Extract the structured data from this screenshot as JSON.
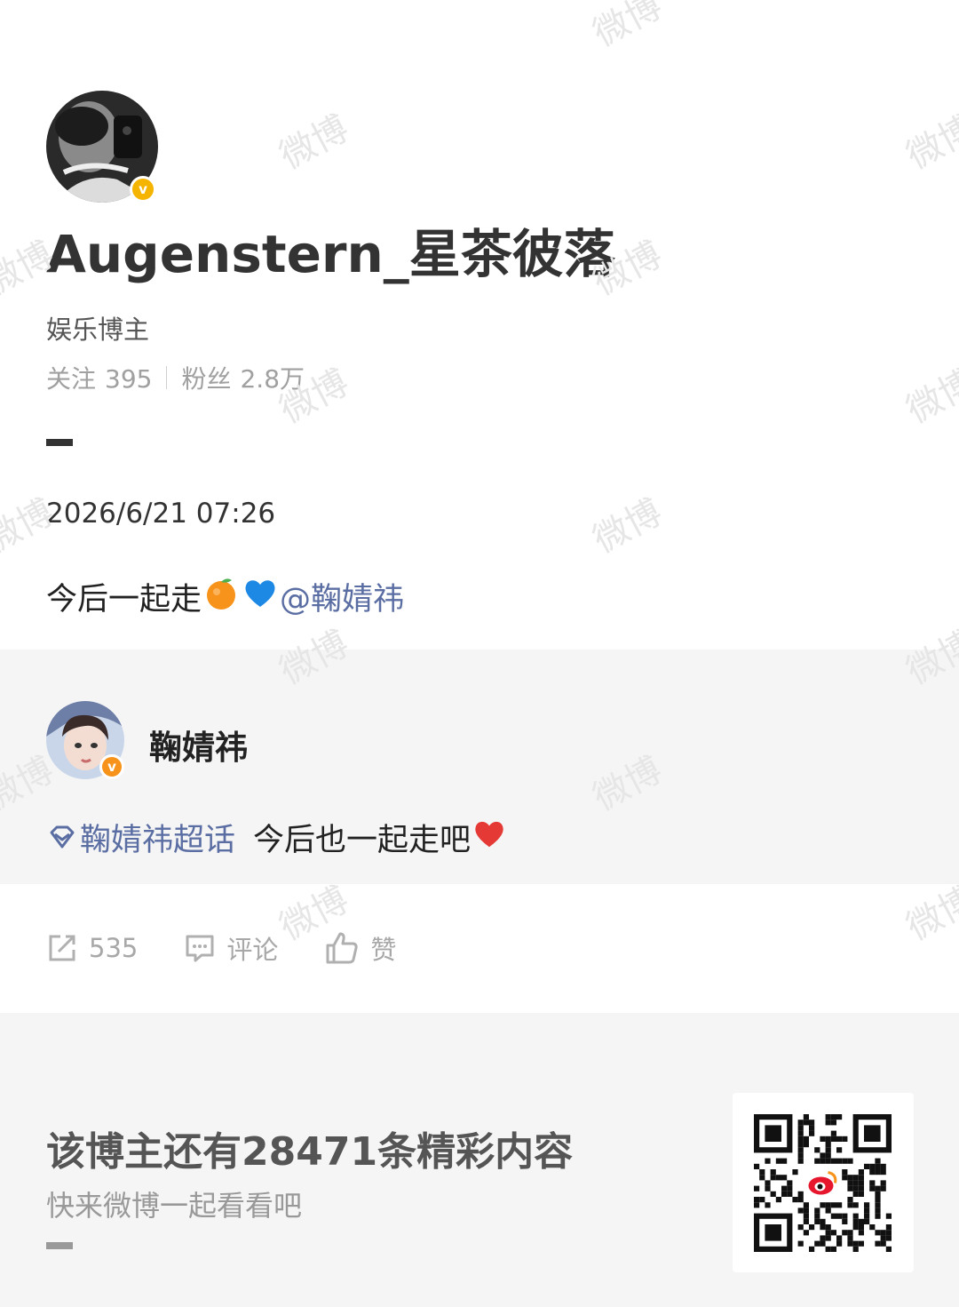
{
  "watermark": "微博",
  "profile": {
    "username": "Augenstern_星茶彼落",
    "blogger_type": "娱乐博主",
    "following_label": "关注",
    "following_count": "395",
    "followers_label": "粉丝",
    "followers_count": "2.8万",
    "verified_badge": "v"
  },
  "post": {
    "time": "2026/6/21 07:26",
    "text": "今后一起走",
    "emojis": [
      "tangerine-emoji",
      "blue-heart-emoji"
    ],
    "mention": "@鞠婧祎"
  },
  "quoted": {
    "name": "鞠婧祎",
    "topic": "鞠婧祎超话",
    "text": "今后也一起走吧",
    "emoji": "red-heart-emoji",
    "verified_badge": "v"
  },
  "actions": {
    "repost_count": "535",
    "comment_label": "评论",
    "like_label": "赞"
  },
  "footer": {
    "title": "该博主还有28471条精彩内容",
    "subtitle": "快来微博一起看看吧"
  },
  "colors": {
    "link": "#5b6ea3",
    "verified_gold": "#f5b400",
    "verified_orange": "#f7931a",
    "muted": "#a0a0a0"
  }
}
